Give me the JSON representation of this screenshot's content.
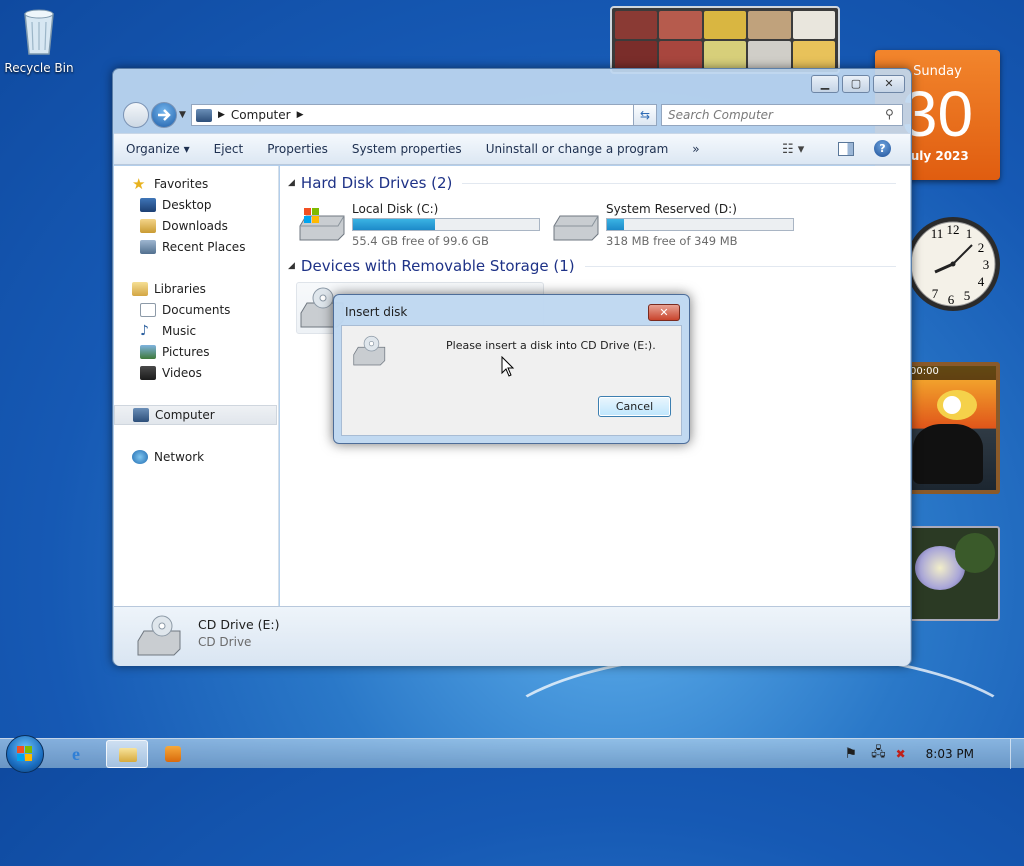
{
  "desktop": {
    "recycle_bin": "Recycle Bin"
  },
  "gadgets": {
    "calendar": {
      "day_name": "Sunday",
      "day_number": "30",
      "month_year": "July 2023"
    },
    "clock_numerals": [
      "12",
      "1",
      "2",
      "3",
      "4",
      "5",
      "6",
      "7",
      "11"
    ],
    "slideshow_timer": "00:00"
  },
  "explorer": {
    "address": {
      "root_icon": "computer-icon",
      "crumb": "Computer"
    },
    "search_placeholder": "Search Computer",
    "toolbar": {
      "organize": "Organize",
      "eject": "Eject",
      "properties": "Properties",
      "system_properties": "System properties",
      "uninstall": "Uninstall or change a program",
      "more": "»"
    },
    "nav": {
      "favorites": "Favorites",
      "desktop": "Desktop",
      "downloads": "Downloads",
      "recent_places": "Recent Places",
      "libraries": "Libraries",
      "documents": "Documents",
      "music": "Music",
      "pictures": "Pictures",
      "videos": "Videos",
      "computer": "Computer",
      "network": "Network"
    },
    "groups": {
      "hard_disks": "Hard Disk Drives (2)",
      "removable": "Devices with Removable Storage (1)"
    },
    "drives": [
      {
        "name": "Local Disk (C:)",
        "free_text": "55.4 GB free of 99.6 GB",
        "used_fraction": 0.44
      },
      {
        "name": "System Reserved (D:)",
        "free_text": "318 MB free of 349 MB",
        "used_fraction": 0.09
      }
    ],
    "details": {
      "name": "CD Drive (E:)",
      "type": "CD Drive"
    }
  },
  "dialog": {
    "title": "Insert disk",
    "message": "Please insert a disk into CD Drive (E:).",
    "cancel": "Cancel",
    "close": "✕"
  },
  "taskbar": {
    "clock": "8:03 PM"
  },
  "colors": {
    "accent": "#1e3287",
    "progress": "#1d8ac9",
    "calendar": "#e05d10"
  }
}
